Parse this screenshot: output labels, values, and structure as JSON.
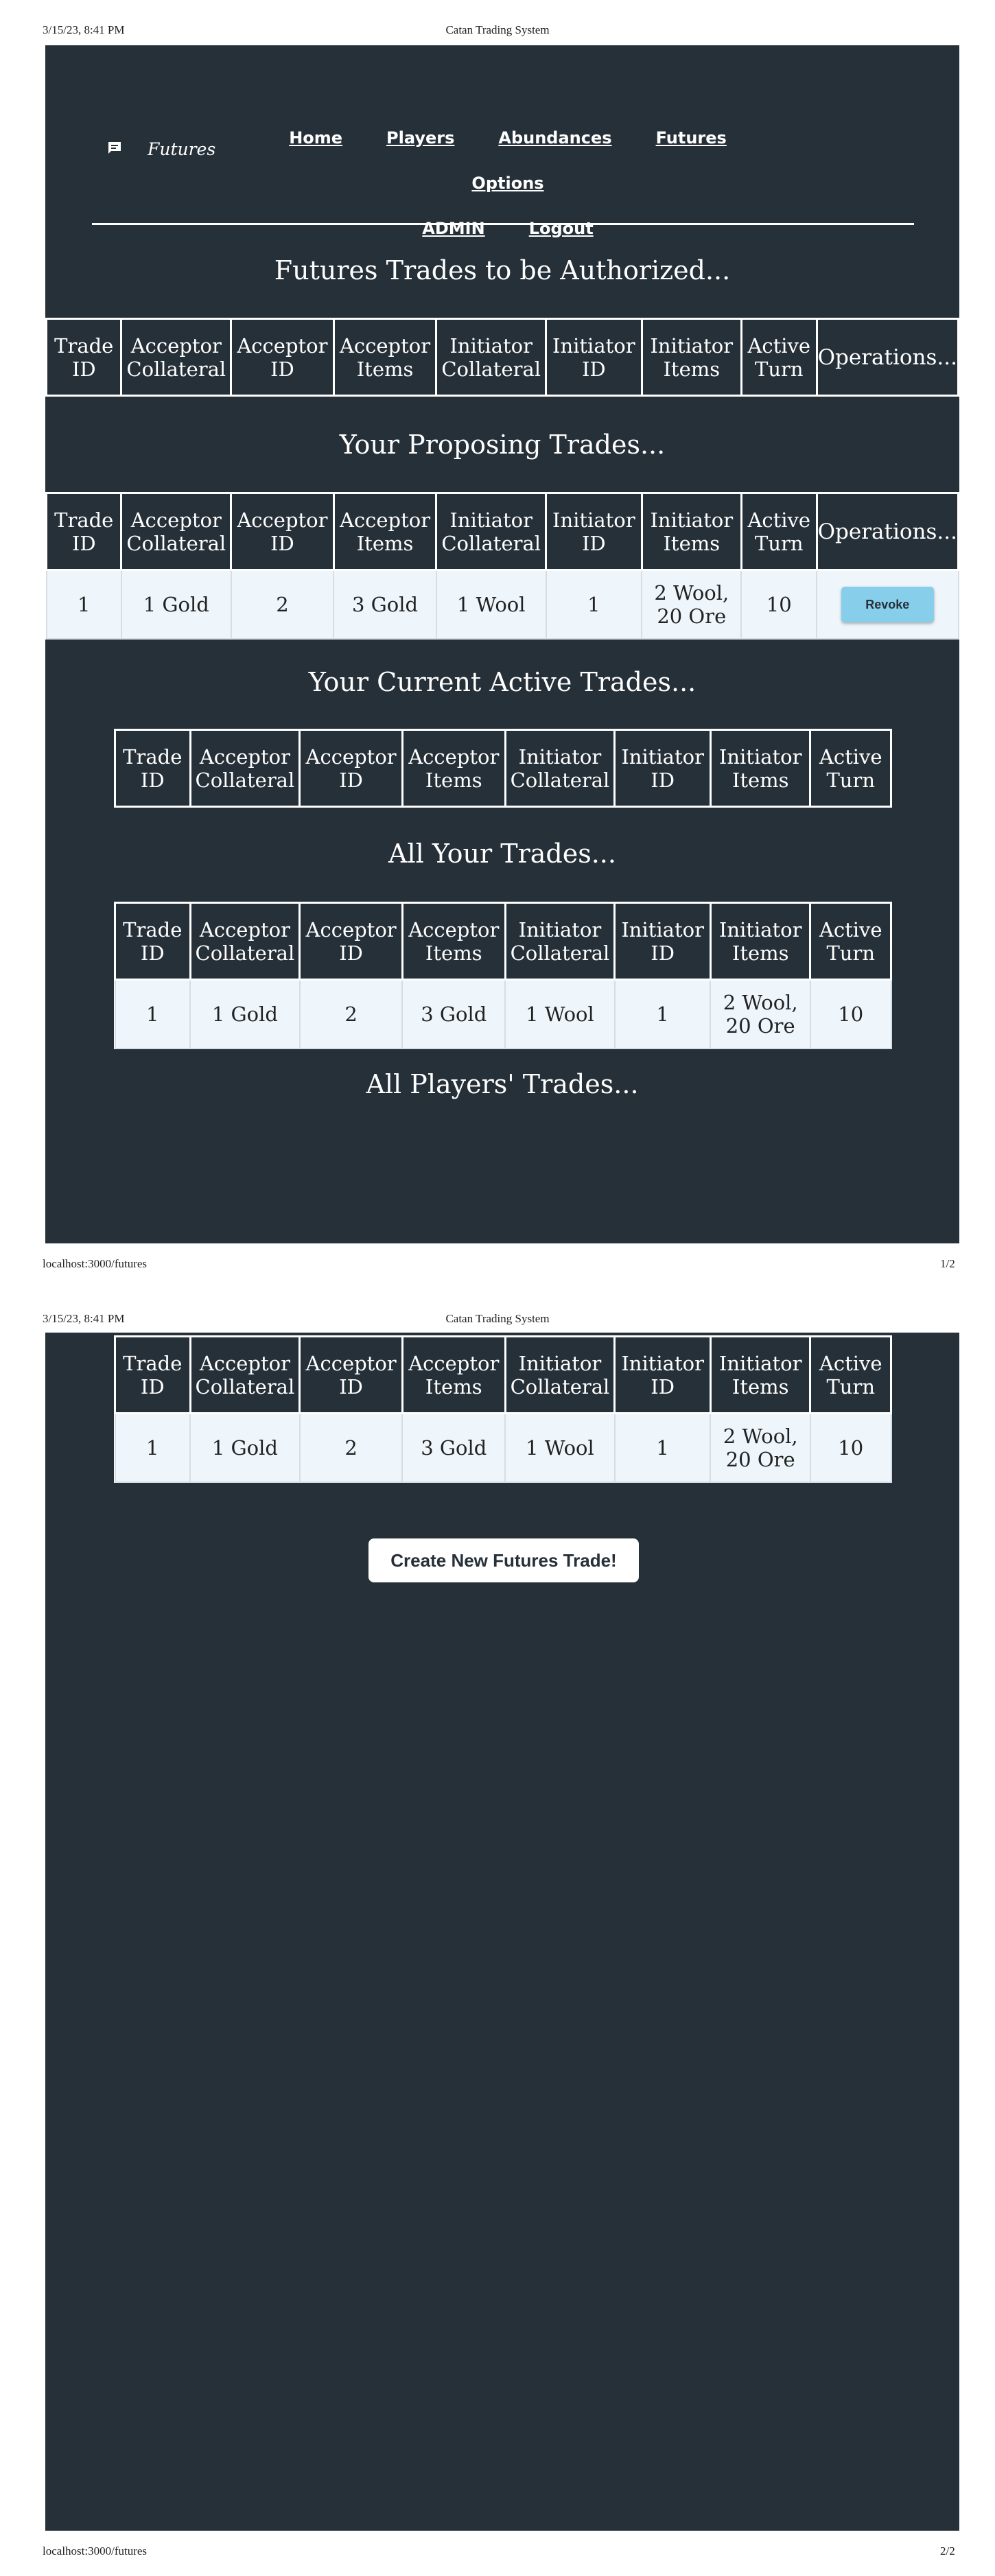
{
  "print": {
    "timestamp": "3/15/23, 8:41 PM",
    "title": "Catan Trading System",
    "url": "localhost:3000/futures",
    "page1": "1/2",
    "page2": "2/2"
  },
  "brand": {
    "label": "Futures",
    "icon": "chat-icon"
  },
  "nav": {
    "home": "Home",
    "players": "Players",
    "abundances": "Abundances",
    "futures": "Futures",
    "options": "Options",
    "admin": "ADMIN",
    "logout": "Logout"
  },
  "headers": {
    "trade_id": "Trade ID",
    "acceptor_collateral": "Acceptor Collateral",
    "acceptor_id": "Acceptor ID",
    "acceptor_items": "Acceptor Items",
    "initiator_collateral": "Initiator Collateral",
    "initiator_id": "Initiator ID",
    "initiator_items": "Initiator Items",
    "active_turn": "Active Turn",
    "operations": "Operations..."
  },
  "sections": {
    "to_authorize": "Futures Trades to be Authorized...",
    "proposing": "Your Proposing Trades...",
    "current_active": "Your Current Active Trades...",
    "all_yours": "All Your Trades...",
    "all_players": "All Players' Trades..."
  },
  "trade": {
    "trade_id": "1",
    "acceptor_collateral": "1 Gold",
    "acceptor_id": "2",
    "acceptor_items": "3 Gold",
    "initiator_collateral": "1 Wool",
    "initiator_id": "1",
    "initiator_items_line1": "2 Wool,",
    "initiator_items_line2": "20 Ore",
    "active_turn": "10"
  },
  "buttons": {
    "revoke": "Revoke",
    "create": "Create New Futures Trade!"
  }
}
